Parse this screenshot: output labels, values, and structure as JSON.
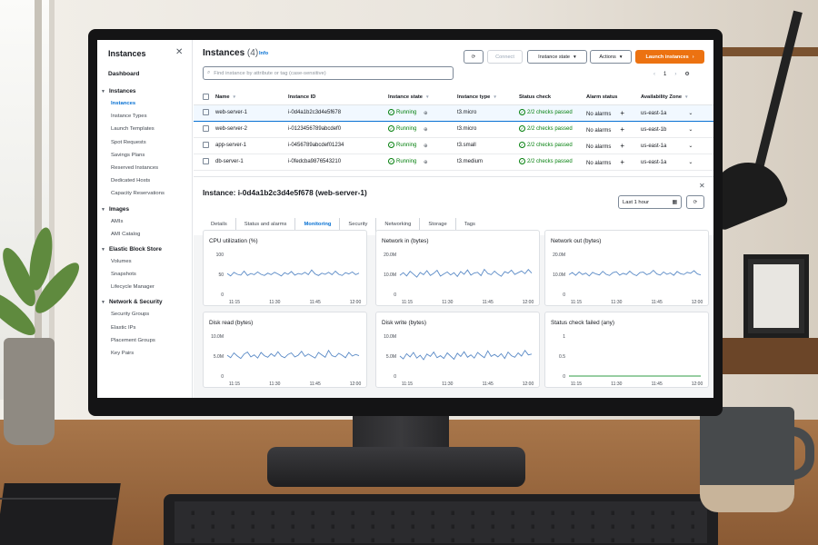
{
  "sidebar": {
    "title": "Instances",
    "dashboard": "Dashboard",
    "sections": [
      {
        "label": "Instances",
        "items": [
          "Instances",
          "Instance Types",
          "Launch Templates",
          "Spot Requests",
          "Savings Plans",
          "Reserved Instances",
          "Dedicated Hosts",
          "Capacity Reservations"
        ]
      },
      {
        "label": "Images",
        "items": [
          "AMIs",
          "AMI Catalog"
        ]
      },
      {
        "label": "Elastic Block Store",
        "items": [
          "Volumes",
          "Snapshots",
          "Lifecycle Manager"
        ]
      },
      {
        "label": "Network & Security",
        "items": [
          "Security Groups",
          "Elastic IPs",
          "Placement Groups",
          "Key Pairs"
        ]
      }
    ],
    "active_item": "Instances"
  },
  "header": {
    "title": "Instances",
    "count": "(4)",
    "info": "Info",
    "connect": "Connect",
    "instance_state": "Instance state",
    "actions": "Actions",
    "launch": "Launch instances"
  },
  "search": {
    "placeholder": "Find instance by attribute or tag (case-sensitive)"
  },
  "pagination": {
    "page": "1"
  },
  "table": {
    "columns": [
      "Name",
      "Instance ID",
      "Instance state",
      "Instance type",
      "Status check",
      "Alarm status",
      "Availability Zone"
    ],
    "rows": [
      {
        "name": "web-server-1",
        "id": "i-0d4a1b2c3d4e5f678",
        "state": "Running",
        "type": "t3.micro",
        "status": "2/2 checks passed",
        "alarm": "No alarms",
        "az": "us-east-1a"
      },
      {
        "name": "web-server-2",
        "id": "i-0123456789abcdef0",
        "state": "Running",
        "type": "t3.micro",
        "status": "2/2 checks passed",
        "alarm": "No alarms",
        "az": "us-east-1b"
      },
      {
        "name": "app-server-1",
        "id": "i-0456789abcdef01234",
        "state": "Running",
        "type": "t3.small",
        "status": "2/2 checks passed",
        "alarm": "No alarms",
        "az": "us-east-1a"
      },
      {
        "name": "db-server-1",
        "id": "i-0fedcba9876543210",
        "state": "Running",
        "type": "t3.medium",
        "status": "2/2 checks passed",
        "alarm": "No alarms",
        "az": "us-east-1a"
      }
    ]
  },
  "detail": {
    "title": "Instance: i-0d4a1b2c3d4e5f678 (web-server-1)",
    "range": "Last 1 hour",
    "tabs": [
      "Details",
      "Status and alarms",
      "Monitoring",
      "Security",
      "Networking",
      "Storage",
      "Tags"
    ],
    "active_tab": "Monitoring"
  },
  "colors": {
    "line": "#5a8ac6",
    "flat_line": "#2f9e44",
    "accent": "#0972d3",
    "primary": "#ec7211",
    "ok": "#037f0c"
  },
  "chart_data": [
    {
      "type": "line",
      "title": "CPU utilization (%)",
      "x": [
        "11:15",
        "11:30",
        "11:45",
        "12:00"
      ],
      "ylim": [
        0,
        100
      ],
      "yticks": [
        "100",
        "50",
        "0"
      ],
      "values": [
        52,
        46,
        55,
        50,
        48,
        58,
        47,
        52,
        49,
        56,
        50,
        47,
        53,
        49,
        55,
        51,
        46,
        54,
        50,
        57,
        48,
        52,
        50,
        55,
        49,
        61,
        51,
        47,
        53,
        50,
        55,
        49,
        58,
        50,
        47,
        54,
        51,
        56,
        49,
        53
      ]
    },
    {
      "type": "line",
      "title": "Network in (bytes)",
      "x": [
        "11:15",
        "11:30",
        "11:45",
        "12:00"
      ],
      "ylim": [
        0,
        20000000
      ],
      "yticks": [
        "20.0M",
        "10.0M",
        "0"
      ],
      "values": [
        9.5,
        10.8,
        9.2,
        11.5,
        10.1,
        8.6,
        10.9,
        9.8,
        11.8,
        9.4,
        10.5,
        12.0,
        9.1,
        10.2,
        11.2,
        9.7,
        10.8,
        8.9,
        11.4,
        10.0,
        12.2,
        9.6,
        10.7,
        11.0,
        9.3,
        12.5,
        10.4,
        9.8,
        11.6,
        10.1,
        9.0,
        11.3,
        10.6,
        12.1,
        9.9,
        10.8,
        11.7,
        10.3,
        12.4,
        10.6
      ]
    },
    {
      "type": "line",
      "title": "Network out (bytes)",
      "x": [
        "11:15",
        "11:30",
        "11:45",
        "12:00"
      ],
      "ylim": [
        0,
        20000000
      ],
      "yticks": [
        "20.0M",
        "10.0M",
        "0"
      ],
      "values": [
        9.8,
        10.9,
        9.5,
        11.2,
        9.9,
        10.6,
        9.2,
        11.0,
        10.2,
        9.7,
        11.5,
        10.0,
        9.4,
        10.8,
        11.3,
        9.6,
        10.5,
        9.9,
        11.6,
        10.1,
        9.3,
        10.9,
        11.1,
        9.8,
        10.4,
        12.0,
        10.2,
        9.6,
        11.2,
        10.0,
        10.7,
        9.5,
        11.4,
        10.3,
        9.9,
        11.0,
        10.5,
        11.8,
        10.2,
        9.7
      ]
    },
    {
      "type": "line",
      "title": "Disk read (bytes)",
      "x": [
        "11:15",
        "11:30",
        "11:45",
        "12:00"
      ],
      "ylim": [
        0,
        10000000
      ],
      "yticks": [
        "10.0M",
        "5.0M",
        "0"
      ],
      "values": [
        5.2,
        4.6,
        5.8,
        5.0,
        4.4,
        5.5,
        6.0,
        4.8,
        5.3,
        4.5,
        5.9,
        5.1,
        4.7,
        5.6,
        4.9,
        6.1,
        5.0,
        4.6,
        5.4,
        5.8,
        4.8,
        5.2,
        6.2,
        4.9,
        5.5,
        5.0,
        4.5,
        5.9,
        5.3,
        4.7,
        6.4,
        5.1,
        4.8,
        5.7,
        5.2,
        4.6,
        5.9,
        5.0,
        5.4,
        5.1
      ]
    },
    {
      "type": "line",
      "title": "Disk write (bytes)",
      "x": [
        "11:15",
        "11:30",
        "11:45",
        "12:00"
      ],
      "ylim": [
        0,
        10000000
      ],
      "yticks": [
        "10.0M",
        "5.0M",
        "0"
      ],
      "values": [
        5.0,
        4.3,
        5.6,
        4.8,
        5.9,
        4.5,
        5.2,
        4.1,
        5.5,
        4.9,
        6.0,
        4.6,
        5.1,
        4.4,
        5.8,
        5.0,
        4.2,
        5.7,
        4.9,
        6.1,
        4.7,
        5.3,
        4.5,
        5.9,
        5.2,
        4.6,
        6.3,
        4.9,
        5.4,
        4.8,
        5.6,
        4.4,
        6.0,
        5.1,
        4.7,
        5.8,
        5.0,
        6.4,
        5.3,
        5.5
      ]
    },
    {
      "type": "line",
      "title": "Status check failed (any)",
      "x": [
        "11:15",
        "11:30",
        "11:45",
        "12:00"
      ],
      "ylim": [
        0,
        1
      ],
      "yticks": [
        "1",
        "0.5",
        "0"
      ],
      "values": [
        0,
        0,
        0,
        0,
        0,
        0,
        0,
        0,
        0,
        0,
        0,
        0,
        0,
        0,
        0,
        0,
        0,
        0,
        0,
        0
      ]
    }
  ]
}
